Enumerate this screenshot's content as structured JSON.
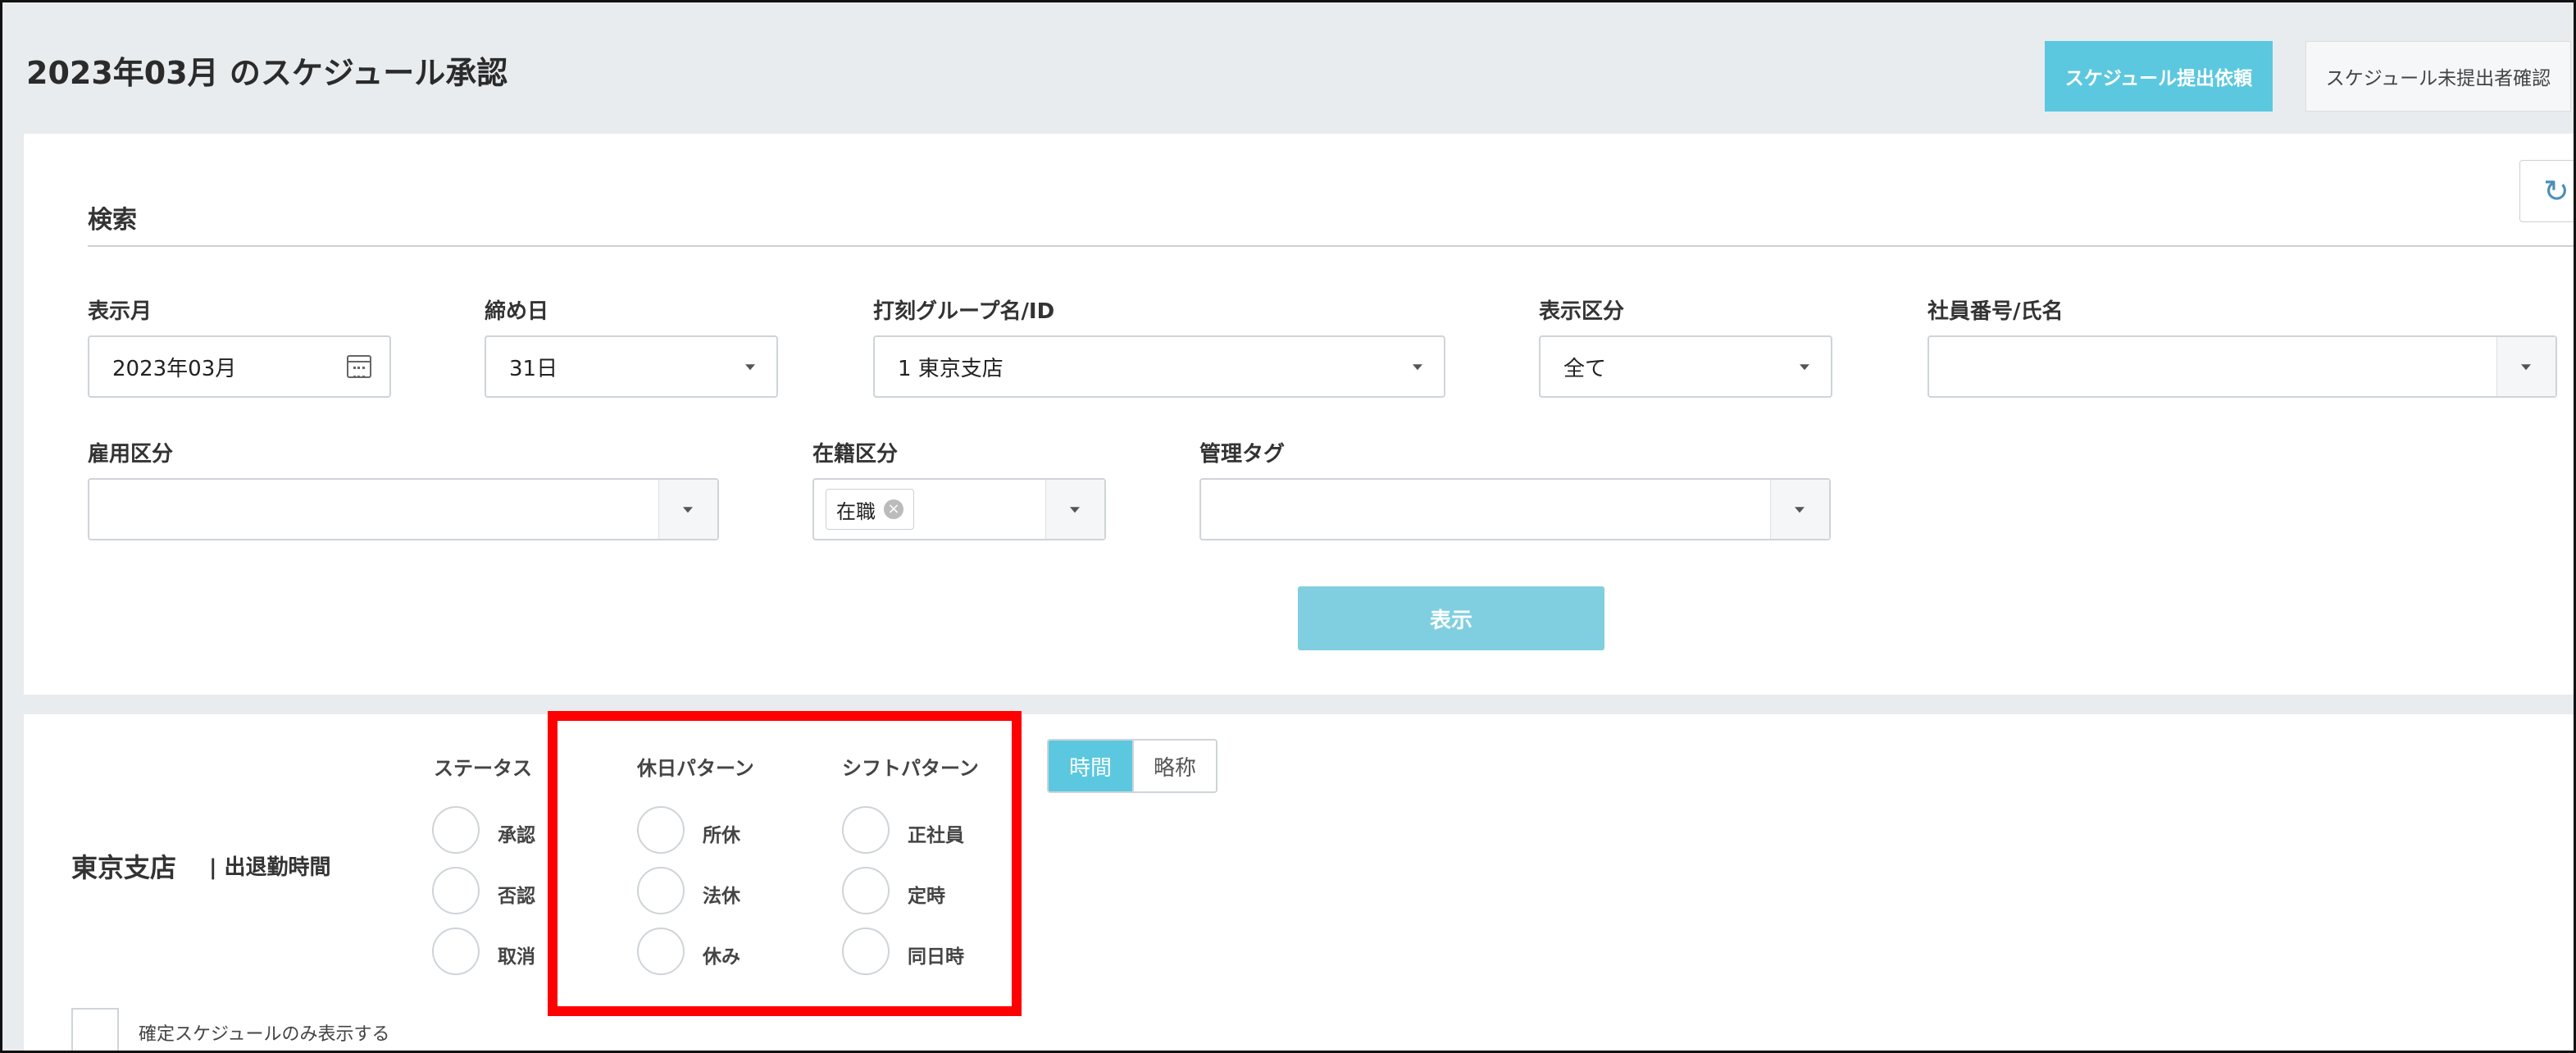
{
  "header": {
    "title": "2023年03月 のスケジュール承認",
    "request_button": "スケジュール提出依頼",
    "unsubmitted_button": "スケジュール未提出者確認"
  },
  "search": {
    "title": "検索",
    "display_month": {
      "label": "表示月",
      "value": "2023年03月"
    },
    "closing_day": {
      "label": "締め日",
      "value": "31日"
    },
    "group": {
      "label": "打刻グループ名/ID",
      "value": "1 東京支店"
    },
    "display_type": {
      "label": "表示区分",
      "value": "全て"
    },
    "employee": {
      "label": "社員番号/氏名",
      "value": ""
    },
    "employment_type": {
      "label": "雇用区分",
      "value": ""
    },
    "enrollment": {
      "label": "在籍区分",
      "tag": "在職",
      "tag_remove": "×"
    },
    "management_tag": {
      "label": "管理タグ",
      "value": ""
    },
    "display_button": "表示"
  },
  "results": {
    "store_name": "東京支店",
    "store_sub": "| 出退勤時間",
    "status": {
      "header": "ステータス",
      "items": [
        "承認",
        "否認",
        "取消"
      ]
    },
    "holiday_pattern": {
      "header": "休日パターン",
      "items": [
        "所休",
        "法休",
        "休み"
      ]
    },
    "shift_pattern": {
      "header": "シフトパターン",
      "items": [
        "正社員",
        "定時",
        "同日時"
      ]
    },
    "toggle": {
      "time": "時間",
      "abbr": "略称"
    },
    "confirmed_only": "確定スケジュールのみ表示する"
  },
  "colors": {
    "accent": "#5bc8df",
    "highlight": "#ff0000"
  },
  "icons": {
    "refresh": "refresh-icon",
    "calendar": "calendar-icon"
  }
}
